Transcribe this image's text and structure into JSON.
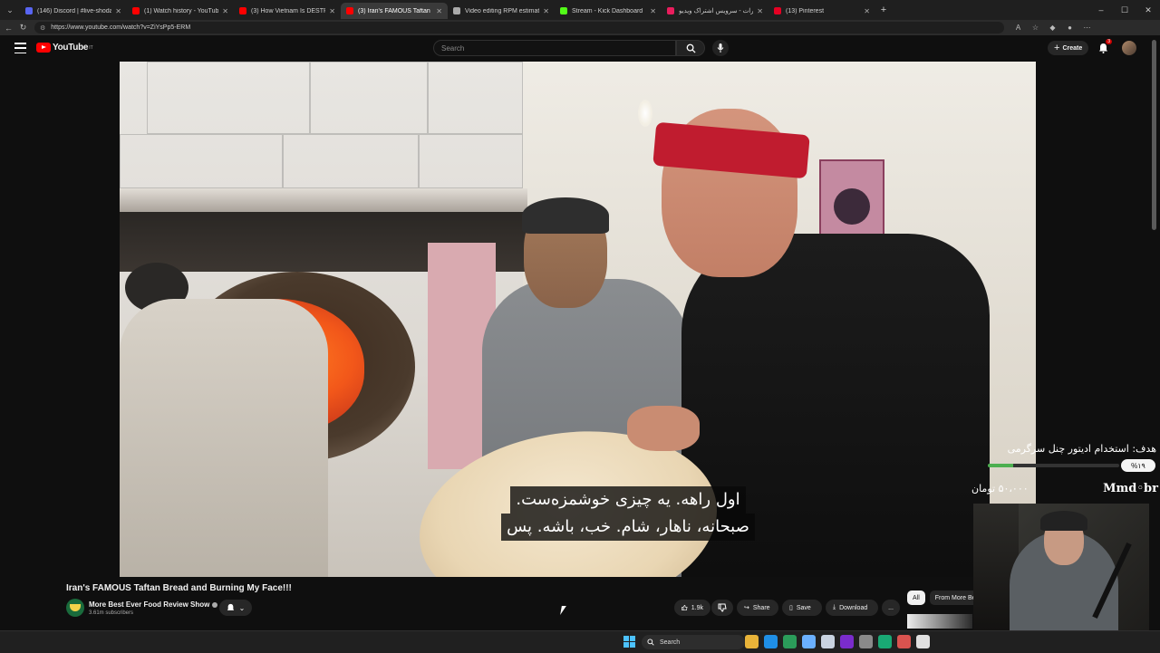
{
  "browser": {
    "tabs": [
      {
        "title": "(146) Discord | #live-shodam | b...",
        "color": "#5865f2",
        "active": false
      },
      {
        "title": "(1) Watch history - YouTube",
        "color": "#ff0000",
        "active": false
      },
      {
        "title": "(3) How Vietnam Is DESTROYING...",
        "color": "#ff0000",
        "active": false
      },
      {
        "title": "(3) Iran's FAMOUS Taftan Br...",
        "color": "#ff0000",
        "active": true
      },
      {
        "title": "Video editing RPM estimate",
        "color": "#aaaaaa",
        "active": false
      },
      {
        "title": "Stream - Kick Dashboard",
        "color": "#53fc18",
        "active": false
      },
      {
        "title": "آپارات - سرویس اشتراک ویدیو",
        "color": "#ea1d5d",
        "active": false
      },
      {
        "title": "(13) Pinterest",
        "color": "#e60023",
        "active": false
      }
    ],
    "url": "https://www.youtube.com/watch?v=ZiYsPp5-ERM"
  },
  "youtube": {
    "logo_text": "YouTube",
    "logo_sup": "IT",
    "search_placeholder": "Search",
    "create_label": "Create",
    "notification_count": "3"
  },
  "video": {
    "caption_line1": "اول راهه. یه چیزی خوشمزه‌ست.",
    "caption_line2": "صبحانه، ناهار، شام. خب، باشه. پس"
  },
  "meta": {
    "title": "Iran's FAMOUS Taftan Bread and Burning My Face!!!",
    "channel": "More Best Ever Food Review Show",
    "subscribers": "3.61m subscribers",
    "likes": "1.9k",
    "share_label": "Share",
    "save_label": "Save",
    "download_label": "Download",
    "more_label": "..."
  },
  "chips": [
    "All",
    "From More Be"
  ],
  "overlay": {
    "goal_text": "هدف: استخدام ادیتور چنل سرگرمی",
    "goal_percent_label": "%۱۹",
    "goal_percent": 19,
    "donation_amount": "۵۰،۰۰۰ تومان",
    "donor": "Mmd◦br"
  },
  "taskbar": {
    "search_label": "Search",
    "apps": [
      "#e8b339",
      "#1f8fe6",
      "#2b9c5a",
      "#6ab0ff",
      "#c9d3e0",
      "#7a2ccc",
      "#8a8a8a",
      "#19a974",
      "#d9534f",
      "#e0e0e0"
    ]
  }
}
